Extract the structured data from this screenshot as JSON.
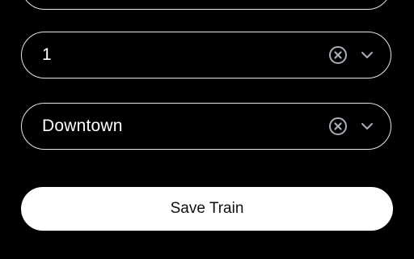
{
  "form": {
    "fields": [
      {
        "value": "1",
        "clear_icon": "clear-circle-x-icon",
        "dropdown_icon": "chevron-down-icon"
      },
      {
        "value": "Downtown",
        "clear_icon": "clear-circle-x-icon",
        "dropdown_icon": "chevron-down-icon"
      }
    ],
    "save_label": "Save Train"
  },
  "colors": {
    "background": "#000000",
    "field_border": "#e6e6e6",
    "field_text": "#ffffff",
    "icon": "#a9adb8",
    "button_bg": "#ffffff",
    "button_text": "#111111"
  }
}
